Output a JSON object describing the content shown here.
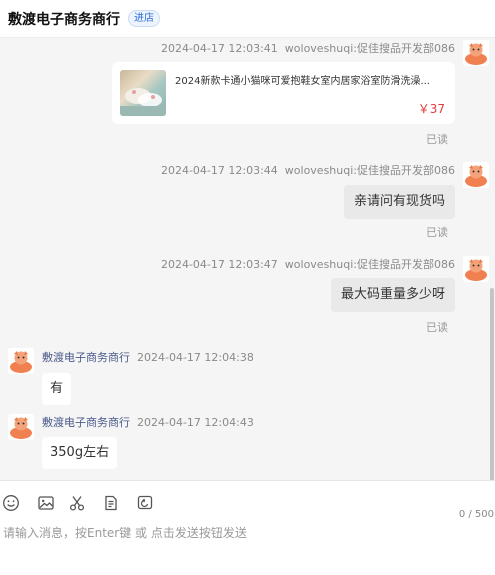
{
  "header": {
    "shop_name": "敷渡电子商务商行",
    "enter_shop_label": "进店"
  },
  "messages": [
    {
      "side": "right",
      "time": "2024-04-17 12:03:41",
      "sender": "woloveshuqi:促佳搜品开发部086",
      "type": "product",
      "product_title": "2024新款卡通小猫咪可爱抱鞋女室内居家浴室防滑洗澡...",
      "product_price": "￥37",
      "status": "已读"
    },
    {
      "side": "right",
      "time": "2024-04-17 12:03:44",
      "sender": "woloveshuqi:促佳搜品开发部086",
      "type": "text",
      "text": "亲请问有现货吗",
      "status": "已读"
    },
    {
      "side": "right",
      "time": "2024-04-17 12:03:47",
      "sender": "woloveshuqi:促佳搜品开发部086",
      "type": "text",
      "text": "最大码重量多少呀",
      "status": "已读"
    },
    {
      "side": "left",
      "time": "2024-04-17 12:04:38",
      "sender": "敷渡电子商务商行",
      "type": "text",
      "text": "有"
    },
    {
      "side": "left",
      "time": "2024-04-17 12:04:43",
      "sender": "敷渡电子商务商行",
      "type": "text",
      "text": "350g左右"
    }
  ],
  "input": {
    "placeholder": "请输入消息，按Enter键 或 点击发送按钮发送",
    "value": "",
    "counter": "0 / 500"
  },
  "toolbar": {
    "tools": [
      "emoji-icon",
      "image-icon",
      "scissors-icon",
      "order-icon",
      "recall-icon"
    ]
  },
  "colors": {
    "price": "#e4393c",
    "avatar": "#f08050",
    "enter_shop": "#2a6cd6"
  }
}
